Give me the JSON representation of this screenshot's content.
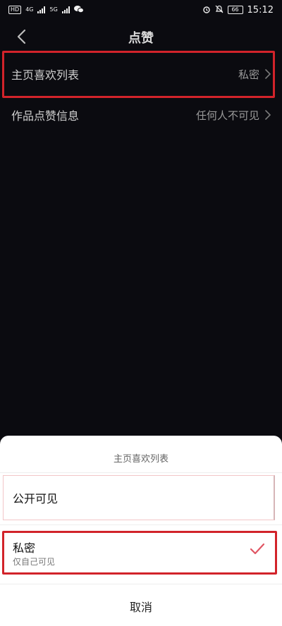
{
  "status_bar": {
    "left_badges": [
      "HD",
      "4G",
      "5G"
    ],
    "battery": "66",
    "time": "15:12"
  },
  "header": {
    "title": "点赞"
  },
  "settings": {
    "rows": [
      {
        "label": "主页喜欢列表",
        "value": "私密"
      },
      {
        "label": "作品点赞信息",
        "value": "任何人不可见"
      }
    ]
  },
  "sheet": {
    "title": "主页喜欢列表",
    "options": [
      {
        "label": "公开可见",
        "subtitle": ""
      },
      {
        "label": "私密",
        "subtitle": "仅自己可见",
        "selected": true
      }
    ],
    "cancel": "取消"
  },
  "colors": {
    "highlight": "#d2232a",
    "check": "#e05563",
    "background": "#0b0b10"
  },
  "icons": [
    "back-icon",
    "chevron-right-icon",
    "check-icon",
    "wifi-icon",
    "alarm-icon",
    "mute-icon"
  ]
}
